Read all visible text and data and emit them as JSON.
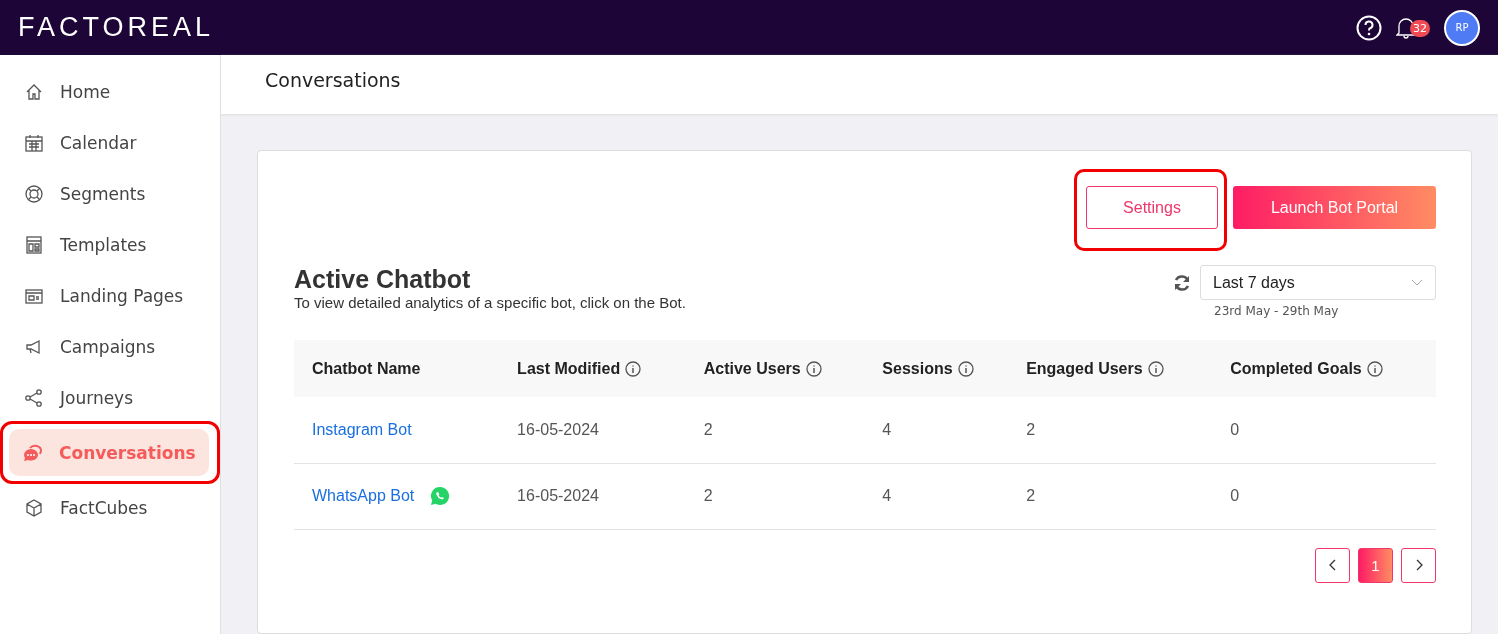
{
  "topbar": {
    "logo": "FACTOREAL",
    "notification_count": "32",
    "avatar_initials": "RP"
  },
  "sidebar": {
    "items": [
      {
        "label": "Home",
        "selected": false,
        "highlighted": false
      },
      {
        "label": "Calendar",
        "selected": false,
        "highlighted": false
      },
      {
        "label": "Segments",
        "selected": false,
        "highlighted": false
      },
      {
        "label": "Templates",
        "selected": false,
        "highlighted": false
      },
      {
        "label": "Landing Pages",
        "selected": false,
        "highlighted": false
      },
      {
        "label": "Campaigns",
        "selected": false,
        "highlighted": false
      },
      {
        "label": "Journeys",
        "selected": false,
        "highlighted": false
      },
      {
        "label": "Conversations",
        "selected": true,
        "highlighted": true
      },
      {
        "label": "FactCubes",
        "selected": false,
        "highlighted": false
      }
    ]
  },
  "page": {
    "title": "Conversations"
  },
  "actions": [
    {
      "label": "Settings",
      "kind": "outline",
      "highlighted": true
    },
    {
      "label": "Launch Bot Portal",
      "kind": "primary",
      "highlighted": false
    }
  ],
  "section": {
    "title": "Active Chatbot",
    "subtitle": "To view detailed analytics of a specific bot, click on the Bot."
  },
  "date_filter": {
    "value": "Last 7 days",
    "range": "23rd May - 29th May"
  },
  "table": {
    "columns": [
      {
        "label": "Chatbot Name",
        "info": false
      },
      {
        "label": "Last Modified",
        "info": true
      },
      {
        "label": "Active Users",
        "info": true
      },
      {
        "label": "Sessions",
        "info": true
      },
      {
        "label": "Engaged Users",
        "info": true
      },
      {
        "label": "Completed Goals",
        "info": true
      }
    ],
    "rows": [
      {
        "whatsapp_icon": false,
        "cells": [
          "Instagram Bot",
          "16-05-2024",
          "2",
          "4",
          "2",
          "0"
        ]
      },
      {
        "whatsapp_icon": true,
        "cells": [
          "WhatsApp Bot",
          "16-05-2024",
          "2",
          "4",
          "2",
          "0"
        ]
      }
    ]
  },
  "pagination": {
    "pages": [
      {
        "label": "1",
        "selected": true
      }
    ]
  }
}
